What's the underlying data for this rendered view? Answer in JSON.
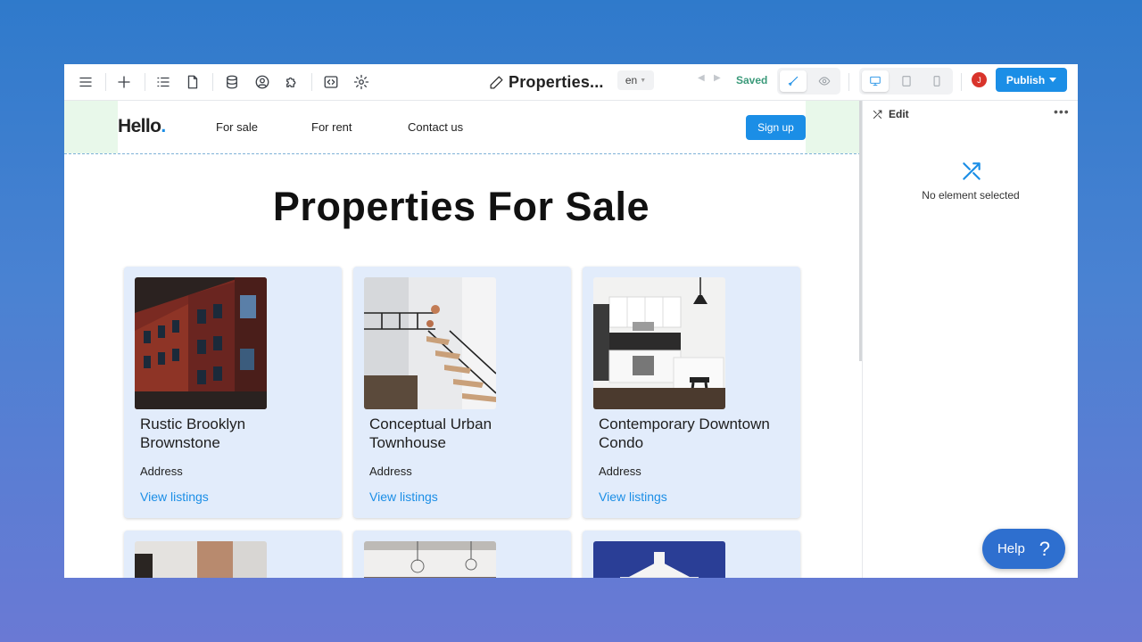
{
  "toolbar": {
    "page_title": "Properties...",
    "language": "en",
    "status": "Saved",
    "avatar_initial": "J",
    "publish_label": "Publish",
    "icons": [
      "menu-icon",
      "plus-icon",
      "list-icon",
      "page-icon",
      "database-icon",
      "user-circle-icon",
      "puzzle-icon",
      "code-icon",
      "gear-icon"
    ]
  },
  "site": {
    "logo": "Hello",
    "logo_dot": ".",
    "nav": [
      "For sale",
      "For rent",
      "Contact us"
    ],
    "signup_label": "Sign up",
    "heading": "Properties For Sale",
    "cards": [
      {
        "name": "Rustic Brooklyn Brownstone",
        "address": "Address",
        "link": "View listings"
      },
      {
        "name": "Conceptual Urban Townhouse",
        "address": "Address",
        "link": "View listings"
      },
      {
        "name": "Contemporary Downtown Condo",
        "address": "Address",
        "link": "View listings"
      }
    ]
  },
  "panel": {
    "title": "Edit",
    "more": "•••",
    "empty_text": "No element selected"
  },
  "help": {
    "label": "Help",
    "glyph": "?"
  },
  "colors": {
    "accent": "#1b8ee6",
    "card_bg": "#e2ecfb",
    "saved": "#3b9a7a",
    "nav_pad": "#e8f8ea"
  }
}
